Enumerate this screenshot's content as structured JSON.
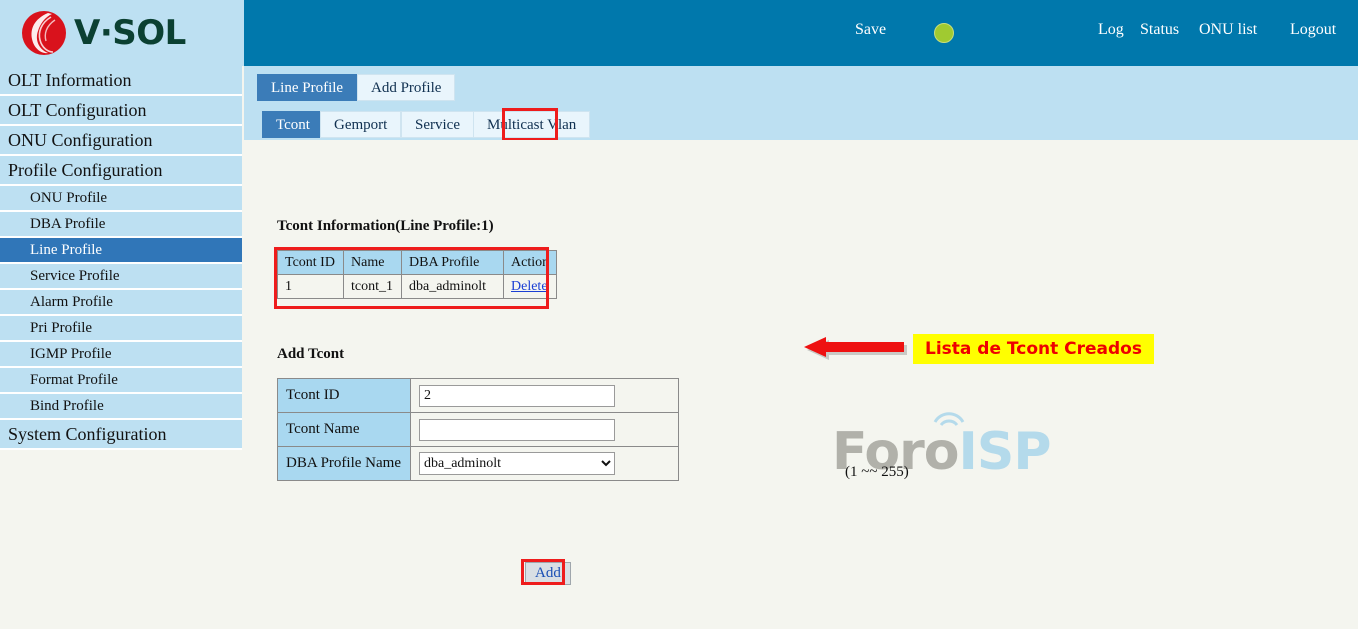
{
  "brand": {
    "name": "V·SOL",
    "logo_icon": "vsol-swirl-logo"
  },
  "header": {
    "save_label": "Save",
    "status_indicator": "green-status-dot",
    "status_color": "#a0ca31",
    "links": [
      {
        "label": "Log"
      },
      {
        "label": "Status"
      },
      {
        "label": "ONU list"
      },
      {
        "label": "Logout"
      }
    ]
  },
  "sidebar": {
    "items": [
      {
        "label": "OLT Information",
        "level": 0,
        "active": false
      },
      {
        "label": "OLT Configuration",
        "level": 0,
        "active": false
      },
      {
        "label": "ONU Configuration",
        "level": 0,
        "active": false
      },
      {
        "label": "Profile Configuration",
        "level": 0,
        "active": false
      },
      {
        "label": "ONU Profile",
        "level": 1,
        "active": false
      },
      {
        "label": "DBA Profile",
        "level": 1,
        "active": false
      },
      {
        "label": "Line Profile",
        "level": 1,
        "active": true
      },
      {
        "label": "Service Profile",
        "level": 1,
        "active": false
      },
      {
        "label": "Alarm Profile",
        "level": 1,
        "active": false
      },
      {
        "label": "Pri Profile",
        "level": 1,
        "active": false
      },
      {
        "label": "IGMP Profile",
        "level": 1,
        "active": false
      },
      {
        "label": "Format Profile",
        "level": 1,
        "active": false
      },
      {
        "label": "Bind Profile",
        "level": 1,
        "active": false
      },
      {
        "label": "System Configuration",
        "level": 0,
        "active": false
      }
    ]
  },
  "tabs": {
    "primary": [
      {
        "label": "Line Profile",
        "active": true
      },
      {
        "label": "Add Profile",
        "active": false
      }
    ],
    "secondary": [
      {
        "label": "Tcont",
        "active": true
      },
      {
        "label": "Gemport",
        "active": false
      },
      {
        "label": "Service",
        "active": false
      },
      {
        "label": "Multicast Vlan",
        "active": false
      }
    ]
  },
  "info_section": {
    "title": "Tcont Information(Line Profile:1)",
    "columns": [
      "Tcont ID",
      "Name",
      "DBA Profile",
      "Action"
    ],
    "rows": [
      {
        "tcont_id": "1",
        "name": "tcont_1",
        "dba_profile": "dba_adminolt",
        "action": "Delete"
      }
    ]
  },
  "annotation": {
    "text": "Lista de Tcont Creados",
    "arrow_icon": "left-arrow-icon",
    "box_color": "#ffff00",
    "text_color": "#ee0000"
  },
  "add_section": {
    "title": "Add Tcont",
    "fields": {
      "tcont_id_label": "Tcont ID",
      "tcont_id_value": "2",
      "tcont_id_hint": "(1 ~~ 255)",
      "tcont_name_label": "Tcont Name",
      "tcont_name_value": "",
      "tcont_name_placeholder": "",
      "dba_profile_label": "DBA Profile Name",
      "dba_profile_value": "dba_adminolt"
    },
    "add_button": "Add"
  },
  "watermark": {
    "part1": "Foro",
    "part2": "ISP"
  }
}
